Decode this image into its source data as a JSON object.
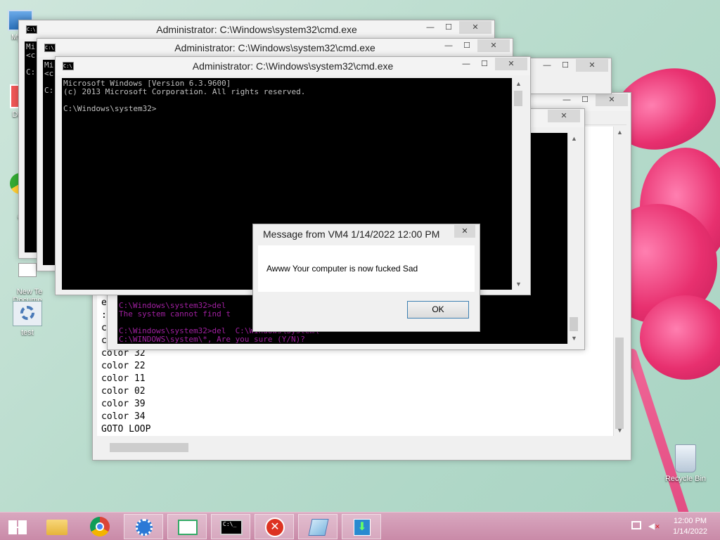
{
  "desktop": {
    "icons": [
      {
        "label": "My C"
      },
      {
        "label": "Data"
      },
      {
        "label": "G\nC"
      },
      {
        "label": "New Te\nDocume"
      },
      {
        "label": "test"
      },
      {
        "label": "Recycle Bin"
      }
    ]
  },
  "cmd_windows": [
    {
      "title": "Administrator: C:\\Windows\\system32\\cmd.exe",
      "lines": "Mi\n<c\n\nC:"
    },
    {
      "title": "Administrator: C:\\Windows\\system32\\cmd.exe",
      "lines": "Mi\n<c\n\nC:"
    },
    {
      "title": "Administrator: C:\\Windows\\system32\\cmd.exe",
      "lines": "Microsoft Windows [Version 6.3.9600]\n(c) 2013 Microsoft Corporation. All rights reserved.\n\nC:\\Windows\\system32>"
    }
  ],
  "purple_console": {
    "lines": "C:\\Windows\\system32>del\nThe system cannot find t\n\nC:\\Windows\\system32>del  C:\\Windows\\System\\\nC:\\WINDOWS\\system\\*, Are you sure (Y/N)?"
  },
  "notepad": {
    "visible_lines": [
      "ec",
      ":l",
      "co",
      "co",
      "color 32",
      "color 22",
      "color 11",
      "color 02",
      "color 39",
      "color 34",
      "GOTO LOOP"
    ]
  },
  "dialog": {
    "title": "Message from VM4 1/14/2022 12:00 PM",
    "message": "Awww Your computer is now fucked Sad",
    "ok_label": "OK",
    "close_glyph": "✕"
  },
  "window_controls": {
    "minimize": "—",
    "maximize": "☐",
    "close": "✕"
  },
  "taskbar": {
    "apps": [
      "start-icon",
      "file-explorer-icon",
      "chrome-icon",
      "control-panel-icon",
      "task-manager-icon",
      "cmd-icon",
      "error-icon",
      "notepad-icon",
      "installer-icon"
    ],
    "clock_time": "12:00 PM",
    "clock_date": "1/14/2022"
  },
  "colors": {
    "console_text": "#c0c0c0",
    "purple_text": "#a020a0",
    "taskbar": "#d19bb4",
    "ok_border": "#3c7fb1"
  }
}
